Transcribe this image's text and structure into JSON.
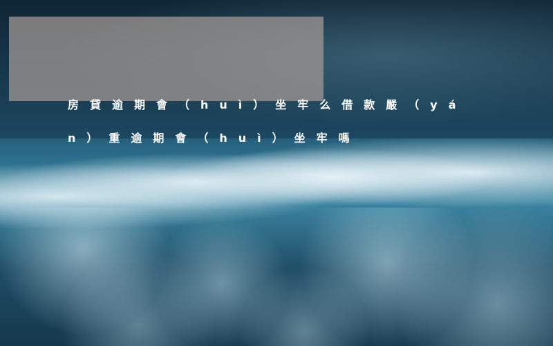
{
  "article": {
    "title": "房貸逾期會（huì）坐牢么借款嚴（yán）重逾期會（huì）坐牢嗎"
  }
}
